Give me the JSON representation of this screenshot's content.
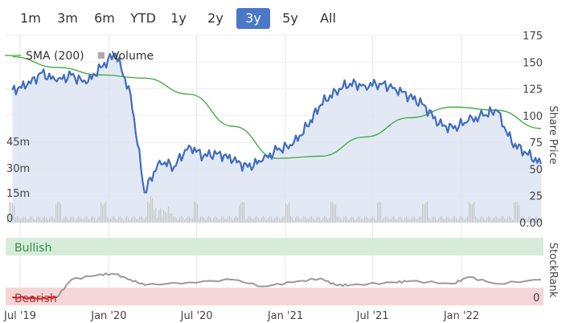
{
  "range_buttons": [
    "1m",
    "3m",
    "6m",
    "YTD",
    "1y",
    "2y",
    "3y",
    "5y",
    "All"
  ],
  "active_range": "3y",
  "colors": {
    "price_line": "#3f6cbd",
    "price_fill": "#dbe4f2",
    "sma_line": "#3aa83a",
    "volume": "#c8c8c8",
    "stockrank_line": "#999999",
    "stockrank_bearish_line": "#cc2222",
    "bullish_band": "#d6ecd9",
    "bearish_band": "#f5d5d5",
    "active_button": "#4a78c8"
  },
  "chart_data": {
    "type": "line",
    "legend": [
      "SMA (200)",
      "Volume"
    ],
    "legend_placement": "top-left",
    "x_ticks": [
      "Jul '19",
      "Jan '20",
      "Jul '20",
      "Jan '21",
      "Jul '21",
      "Jan '22"
    ],
    "y_right": {
      "label": "Share Price",
      "ticks": [
        "175",
        "150",
        "125",
        "100",
        "75",
        "50",
        "25",
        "0.00"
      ],
      "range": [
        0,
        175
      ]
    },
    "y_left": {
      "label": "Volume",
      "ticks": [
        "45m",
        "30m",
        "15m",
        "0"
      ]
    },
    "series": [
      {
        "name": "Share Price",
        "x": [
          "2019-06",
          "2019-07",
          "2019-08",
          "2019-09",
          "2019-10",
          "2019-11",
          "2019-12",
          "2020-01",
          "2020-02",
          "2020-03",
          "2020-04",
          "2020-05",
          "2020-06",
          "2020-07",
          "2020-08",
          "2020-09",
          "2020-10",
          "2020-11",
          "2020-12",
          "2021-01",
          "2021-02",
          "2021-03",
          "2021-04",
          "2021-05",
          "2021-06",
          "2021-07",
          "2021-08",
          "2021-09",
          "2021-10",
          "2021-11",
          "2021-12",
          "2022-01",
          "2022-02",
          "2022-03",
          "2022-04",
          "2022-05",
          "2022-06"
        ],
        "values": [
          124,
          128,
          140,
          132,
          138,
          130,
          145,
          158,
          120,
          28,
          58,
          52,
          72,
          62,
          65,
          58,
          52,
          58,
          68,
          72,
          90,
          110,
          123,
          130,
          128,
          130,
          126,
          118,
          110,
          92,
          88,
          95,
          100,
          105,
          75,
          65,
          55
        ]
      },
      {
        "name": "SMA (200)",
        "x": [
          "2019-06",
          "2019-09",
          "2019-12",
          "2020-03",
          "2020-06",
          "2020-09",
          "2020-12",
          "2021-03",
          "2021-06",
          "2021-09",
          "2021-12",
          "2022-03",
          "2022-06"
        ],
        "values": [
          155,
          145,
          138,
          135,
          120,
          90,
          60,
          62,
          80,
          98,
          108,
          105,
          88
        ]
      }
    ],
    "stockrank": {
      "bands": [
        "Bullish",
        "Bearish"
      ],
      "right_label": "StockRank",
      "right_tick": "0",
      "x": [
        "2019-06",
        "2019-08",
        "2019-09",
        "2019-10",
        "2019-12",
        "2020-01",
        "2020-02",
        "2020-03",
        "2020-06",
        "2020-09",
        "2020-11",
        "2021-01",
        "2021-03",
        "2021-04",
        "2021-05",
        "2021-08",
        "2021-09",
        "2021-12",
        "2022-01",
        "2022-03",
        "2022-06"
      ],
      "values": [
        12,
        10,
        12,
        38,
        46,
        46,
        38,
        30,
        34,
        38,
        28,
        34,
        40,
        30,
        30,
        34,
        36,
        32,
        42,
        32,
        38
      ]
    }
  }
}
